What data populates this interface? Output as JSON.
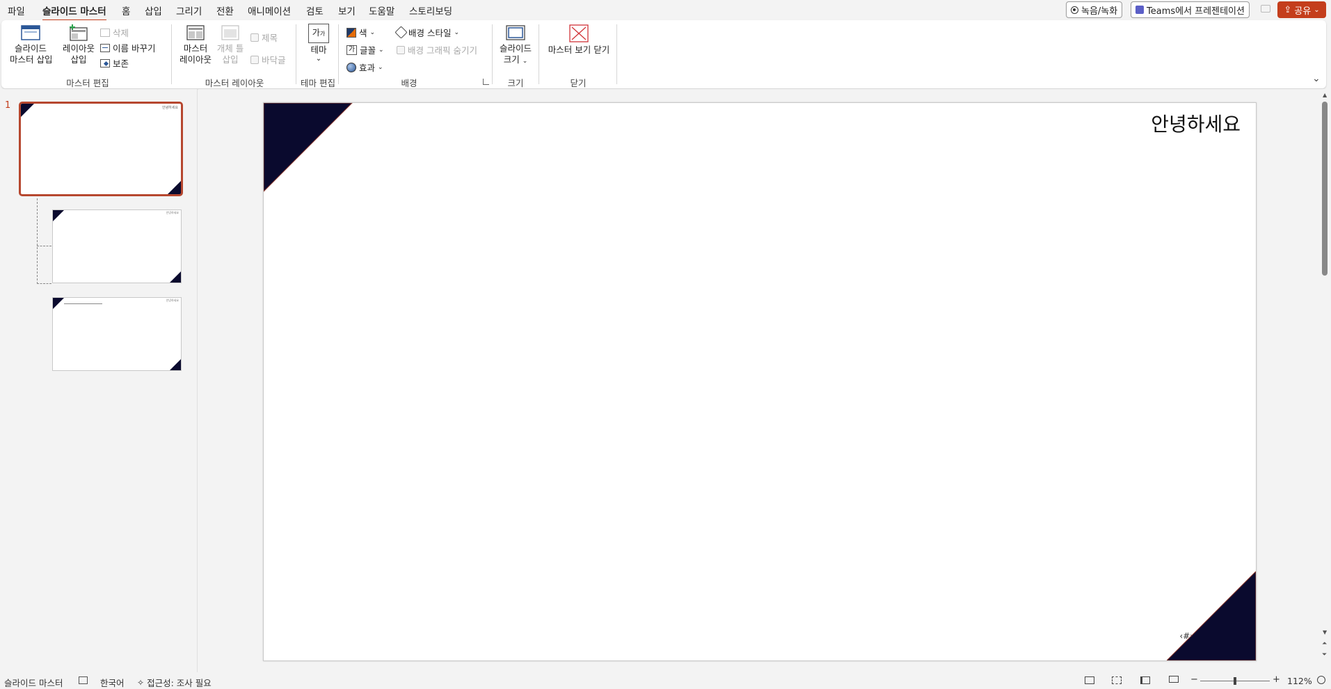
{
  "tabs": [
    "파일",
    "슬라이드 마스터",
    "홈",
    "삽입",
    "그리기",
    "전환",
    "애니메이션",
    "검토",
    "보기",
    "도움말",
    "스토리보딩"
  ],
  "active_tab": "슬라이드 마스터",
  "top_right": {
    "record": "녹음/녹화",
    "teams": "Teams에서 프레젠테이션",
    "share": "공유"
  },
  "ribbon": {
    "edit_master": {
      "insert_slide_master": [
        "슬라이드",
        "마스터 삽입"
      ],
      "insert_layout": [
        "레이아웃",
        "삽입"
      ],
      "delete": "삭제",
      "rename": "이름 바꾸기",
      "preserve": "보존",
      "label": "마스터 편집"
    },
    "master_layout": {
      "master_layout_btn": [
        "마스터",
        "레이아웃"
      ],
      "insert_placeholder": [
        "개체 틀",
        "삽입"
      ],
      "title_chk": "제목",
      "footer_chk": "바닥글",
      "label": "마스터 레이아웃"
    },
    "edit_theme": {
      "themes": "테마",
      "label": "테마 편집"
    },
    "background": {
      "colors": "색",
      "fonts": "글꼴",
      "effects": "효과",
      "bg_styles": "배경 스타일",
      "hide_bg_graphics": "배경 그래픽 숨기기",
      "label": "배경"
    },
    "size": {
      "slide_size": [
        "슬라이드",
        "크기"
      ],
      "label": "크기"
    },
    "close": {
      "close_master": "마스터 보기 닫기",
      "label": "닫기"
    }
  },
  "thumbnails": {
    "slide_number": "1",
    "thumb_title_text": "안녕하세요"
  },
  "slide": {
    "title": "안녕하세요",
    "page_number": "‹#›",
    "accent_color": "#0a0a2e",
    "triangle_edge_color": "#8b3a2f"
  },
  "status": {
    "view": "슬라이드 마스터",
    "language": "한국어",
    "accessibility": "접근성: 조사 필요",
    "zoom": "112%"
  },
  "colors": {
    "accent": "#c43e1c"
  }
}
